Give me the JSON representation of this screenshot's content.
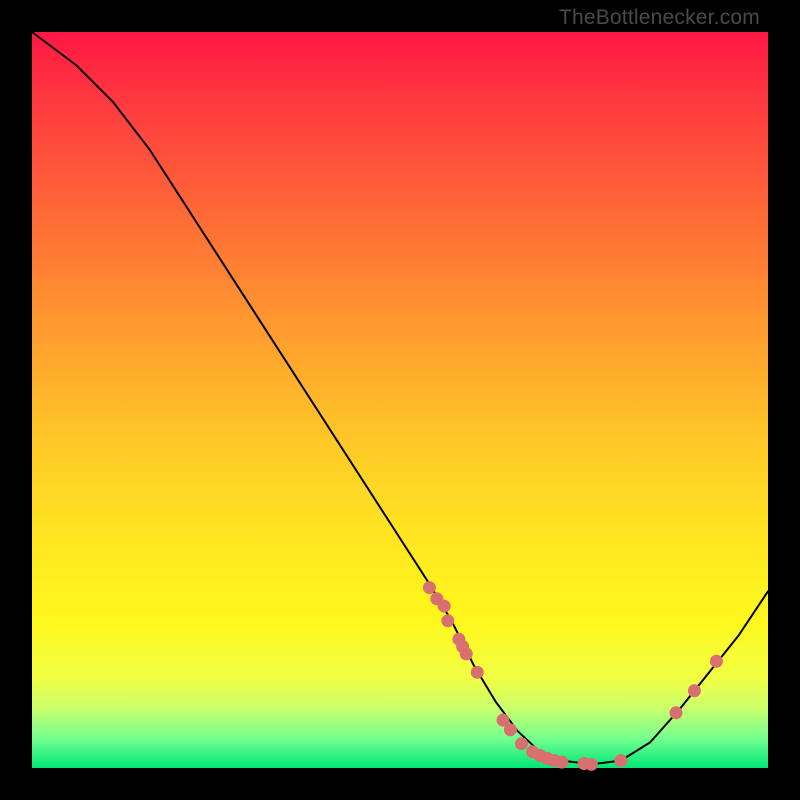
{
  "watermark": {
    "text": "TheBottlenecker.com"
  },
  "chart_data": {
    "type": "line",
    "title": "",
    "xlabel": "",
    "ylabel": "",
    "xlim": [
      0,
      100
    ],
    "ylim": [
      0,
      100
    ],
    "grid": false,
    "curve": [
      {
        "x": 0,
        "y": 100
      },
      {
        "x": 6,
        "y": 95.5
      },
      {
        "x": 11,
        "y": 90.5
      },
      {
        "x": 16,
        "y": 84
      },
      {
        "x": 54,
        "y": 25
      },
      {
        "x": 57,
        "y": 20
      },
      {
        "x": 60,
        "y": 14
      },
      {
        "x": 63,
        "y": 9
      },
      {
        "x": 66,
        "y": 5
      },
      {
        "x": 69,
        "y": 2.2
      },
      {
        "x": 72,
        "y": 1
      },
      {
        "x": 76,
        "y": 0.5
      },
      {
        "x": 80,
        "y": 1
      },
      {
        "x": 84,
        "y": 3.5
      },
      {
        "x": 88,
        "y": 8
      },
      {
        "x": 92,
        "y": 13
      },
      {
        "x": 96,
        "y": 18
      },
      {
        "x": 100,
        "y": 24
      }
    ],
    "points": [
      {
        "x": 54,
        "y": 24.5
      },
      {
        "x": 55,
        "y": 23
      },
      {
        "x": 56,
        "y": 22
      },
      {
        "x": 56.5,
        "y": 20
      },
      {
        "x": 58,
        "y": 17.5
      },
      {
        "x": 58.5,
        "y": 16.5
      },
      {
        "x": 59,
        "y": 15.5
      },
      {
        "x": 60.5,
        "y": 13
      },
      {
        "x": 64,
        "y": 6.5
      },
      {
        "x": 65,
        "y": 5.2
      },
      {
        "x": 66.5,
        "y": 3.3
      },
      {
        "x": 68,
        "y": 2.2
      },
      {
        "x": 69,
        "y": 1.7
      },
      {
        "x": 70,
        "y": 1.3
      },
      {
        "x": 71,
        "y": 1
      },
      {
        "x": 72,
        "y": 0.8
      },
      {
        "x": 75,
        "y": 0.6
      },
      {
        "x": 76,
        "y": 0.5
      },
      {
        "x": 80,
        "y": 1
      },
      {
        "x": 87.5,
        "y": 7.5
      },
      {
        "x": 90,
        "y": 10.5
      },
      {
        "x": 93,
        "y": 14.5
      }
    ],
    "colors": {
      "curve_stroke": "#000000",
      "point_fill": "#d87070",
      "gradient_top": "#ff1744",
      "gradient_bottom": "#00e676"
    }
  }
}
